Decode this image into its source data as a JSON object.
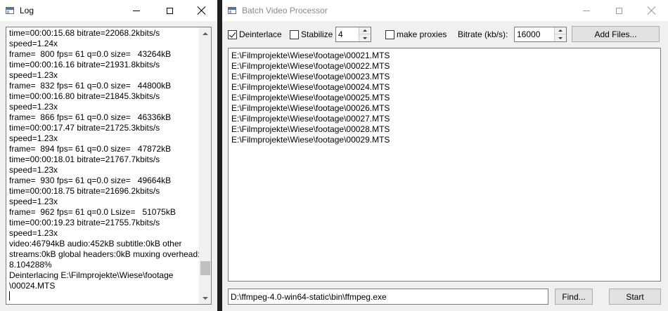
{
  "log_window": {
    "title": "Log",
    "lines": [
      "time=00:00:15.68 bitrate=22068.2kbits/s",
      "speed=1.24x",
      "frame=  800 fps= 61 q=0.0 size=   43264kB",
      "time=00:00:16.16 bitrate=21931.8kbits/s",
      "speed=1.23x",
      "frame=  832 fps= 61 q=0.0 size=   44800kB",
      "time=00:00:16.80 bitrate=21845.3kbits/s",
      "speed=1.23x",
      "frame=  866 fps= 61 q=0.0 size=   46336kB",
      "time=00:00:17.47 bitrate=21725.3kbits/s",
      "speed=1.23x",
      "frame=  894 fps= 61 q=0.0 size=   47872kB",
      "time=00:00:18.01 bitrate=21767.7kbits/s",
      "speed=1.23x",
      "frame=  930 fps= 61 q=0.0 size=   49664kB",
      "time=00:00:18.75 bitrate=21696.2kbits/s",
      "speed=1.23x",
      "frame=  962 fps= 61 q=0.0 Lsize=   51075kB",
      "time=00:00:19.23 bitrate=21755.7kbits/s",
      "speed=1.23x",
      "video:46794kB audio:452kB subtitle:0kB other",
      "streams:0kB global headers:0kB muxing overhead:",
      "8.104288%",
      "Deinterlacing E:\\Filmprojekte\\Wiese\\footage",
      "\\00024.MTS"
    ],
    "scroll_position": 0.93
  },
  "main_window": {
    "title": "Batch Video Processor",
    "options": {
      "deinterlace": {
        "label": "Deinterlace",
        "checked": true
      },
      "stabilize": {
        "label": "Stabilize",
        "checked": false,
        "value": "4"
      },
      "make_proxies": {
        "label": "make proxies",
        "checked": false
      },
      "bitrate": {
        "label": "Bitrate (kb/s):",
        "value": "16000"
      }
    },
    "add_files_label": "Add Files...",
    "files": [
      "E:\\Filmprojekte\\Wiese\\footage\\00021.MTS",
      "E:\\Filmprojekte\\Wiese\\footage\\00022.MTS",
      "E:\\Filmprojekte\\Wiese\\footage\\00023.MTS",
      "E:\\Filmprojekte\\Wiese\\footage\\00024.MTS",
      "E:\\Filmprojekte\\Wiese\\footage\\00025.MTS",
      "E:\\Filmprojekte\\Wiese\\footage\\00026.MTS",
      "E:\\Filmprojekte\\Wiese\\footage\\00027.MTS",
      "E:\\Filmprojekte\\Wiese\\footage\\00028.MTS",
      "E:\\Filmprojekte\\Wiese\\footage\\00029.MTS"
    ],
    "ffmpeg_path": "D:\\ffmpeg-4.0-win64-static\\bin\\ffmpeg.exe",
    "find_label": "Find...",
    "start_label": "Start"
  },
  "icons": {
    "window_controls": [
      "minimize-icon",
      "maximize-icon",
      "close-icon"
    ],
    "app": "window-app-icon"
  }
}
